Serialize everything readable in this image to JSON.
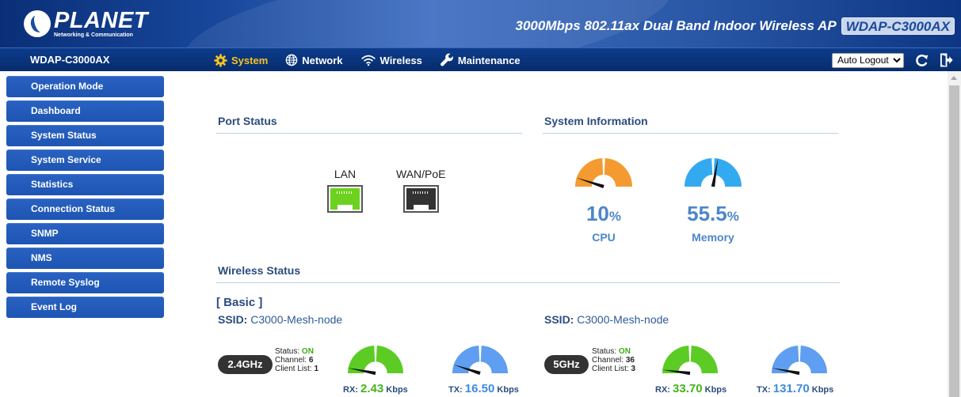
{
  "header": {
    "logo_name": "PLANET",
    "logo_tagline": "Networking & Communication",
    "product_title": "3000Mbps 802.11ax Dual Band Indoor Wireless AP",
    "model_badge": "WDAP-C3000AX"
  },
  "navbar": {
    "model": "WDAP-C3000AX",
    "menu": [
      {
        "label": "System",
        "icon": "gear-icon",
        "active": true
      },
      {
        "label": "Network",
        "icon": "globe-icon",
        "active": false
      },
      {
        "label": "Wireless",
        "icon": "wifi-icon",
        "active": false
      },
      {
        "label": "Maintenance",
        "icon": "wrench-icon",
        "active": false
      }
    ],
    "auto_logout": "Auto Logout",
    "refresh_icon": "refresh-icon",
    "logout_icon": "logout-icon"
  },
  "sidebar": {
    "items": [
      {
        "label": "Operation Mode"
      },
      {
        "label": "Dashboard"
      },
      {
        "label": "System Status"
      },
      {
        "label": "System Service"
      },
      {
        "label": "Statistics"
      },
      {
        "label": "Connection Status"
      },
      {
        "label": "SNMP"
      },
      {
        "label": "NMS"
      },
      {
        "label": "Remote Syslog"
      },
      {
        "label": "Event Log"
      }
    ]
  },
  "port_status": {
    "title": "Port Status",
    "ports": [
      {
        "label": "LAN",
        "state": "connected",
        "color": "#6cd21f"
      },
      {
        "label": "WAN/PoE",
        "state": "disconnected",
        "color": "#333333"
      }
    ]
  },
  "system_info": {
    "title": "System Information",
    "cpu": {
      "value": "10",
      "unit": "%",
      "label": "CPU",
      "color": "#f39b31",
      "fraction": 0.1
    },
    "memory": {
      "value": "55.5",
      "unit": "%",
      "label": "Memory",
      "color": "#33aaf0",
      "fraction": 0.555
    }
  },
  "wireless_status": {
    "title": "Wireless Status",
    "basic_title": "[ Basic ]",
    "bands": [
      {
        "badge": "2.4GHz",
        "ssid_label": "SSID:",
        "ssid": "C3000-Mesh-node",
        "status_label": "Status:",
        "status": "ON",
        "channel_label": "Channel:",
        "channel": "6",
        "clients_label": "Client List:",
        "clients": "1",
        "rx_label": "RX:",
        "rx_value": "2.43",
        "tx_label": "TX:",
        "tx_value": "16.50",
        "unit": "Kbps",
        "rx_fraction": 0.06,
        "tx_fraction": 0.1
      },
      {
        "badge": "5GHz",
        "ssid_label": "SSID:",
        "ssid": "C3000-Mesh-node",
        "status_label": "Status:",
        "status": "ON",
        "channel_label": "Channel:",
        "channel": "36",
        "clients_label": "Client List:",
        "clients": "3",
        "rx_label": "RX:",
        "rx_value": "33.70",
        "tx_label": "TX:",
        "tx_value": "131.70",
        "unit": "Kbps",
        "rx_fraction": 0.04,
        "tx_fraction": 0.06
      }
    ],
    "rx_color": "#5ccc25",
    "tx_color": "#5f9ef0"
  }
}
